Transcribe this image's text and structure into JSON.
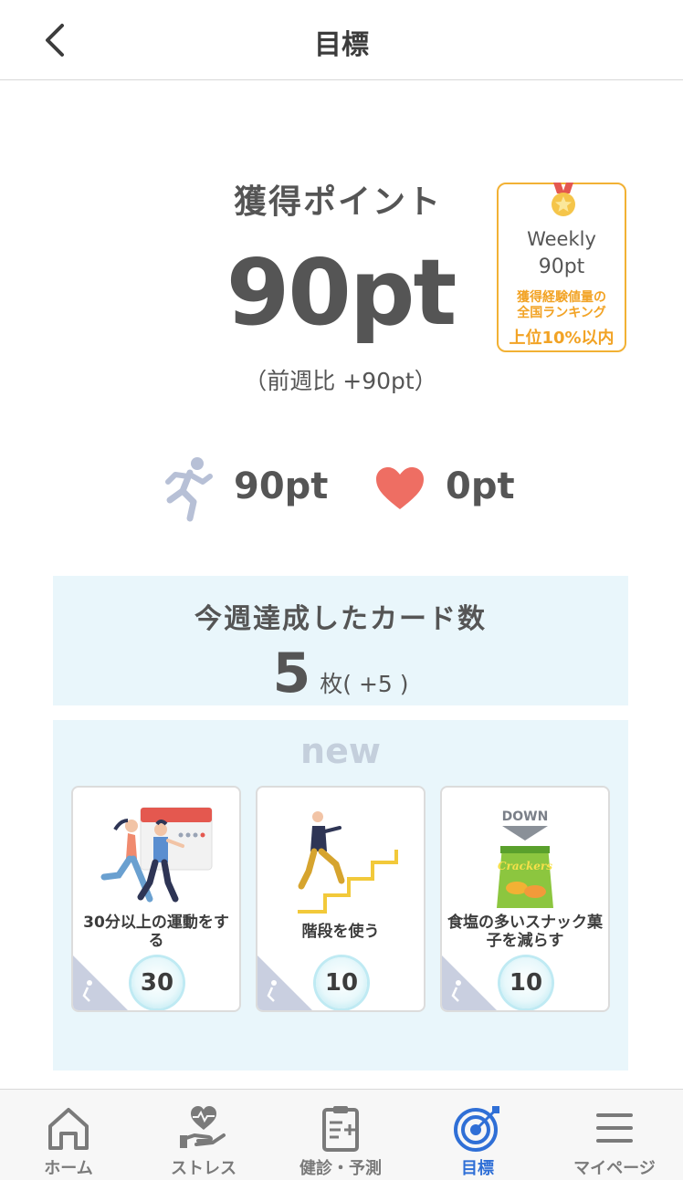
{
  "header": {
    "title": "目標",
    "back_icon": "chevron-left-icon"
  },
  "points": {
    "label": "獲得ポイント",
    "value": "90pt",
    "compare": "（前週比 +90pt）"
  },
  "badge": {
    "icon": "medal-icon",
    "weekly": "Weekly",
    "points": "90pt",
    "description_line1": "獲得経験値量の",
    "description_line2": "全国ランキング",
    "rank": "上位10%以内",
    "color": "#f2a325"
  },
  "breakdown": {
    "exercise_icon": "runner-icon",
    "exercise_points": "90pt",
    "heart_icon": "heart-icon",
    "heart_points": "0pt"
  },
  "weekly_cards": {
    "title": "今週達成したカード数",
    "count": "5",
    "unit": "枚",
    "diff": "( +5 )"
  },
  "new_section": {
    "label": "new",
    "cards": [
      {
        "text": "30分以上の運動をする",
        "points": "30",
        "illustration": "couple-jogging-calendar"
      },
      {
        "text": "階段を使う",
        "points": "10",
        "illustration": "person-climbing-stairs"
      },
      {
        "text": "食塩の多いスナック菓子を減らす",
        "points": "10",
        "illustration": "crackers-bag-down",
        "down_label": "DOWN",
        "bag_label": "Crackers"
      }
    ]
  },
  "nav": {
    "active_color": "#2f6fd6",
    "items": [
      {
        "label": "ホーム",
        "icon": "home-icon"
      },
      {
        "label": "ストレス",
        "icon": "heart-hand-icon"
      },
      {
        "label": "健診・予測",
        "icon": "clipboard-icon"
      },
      {
        "label": "目標",
        "icon": "target-icon"
      },
      {
        "label": "マイページ",
        "icon": "menu-icon"
      }
    ]
  }
}
